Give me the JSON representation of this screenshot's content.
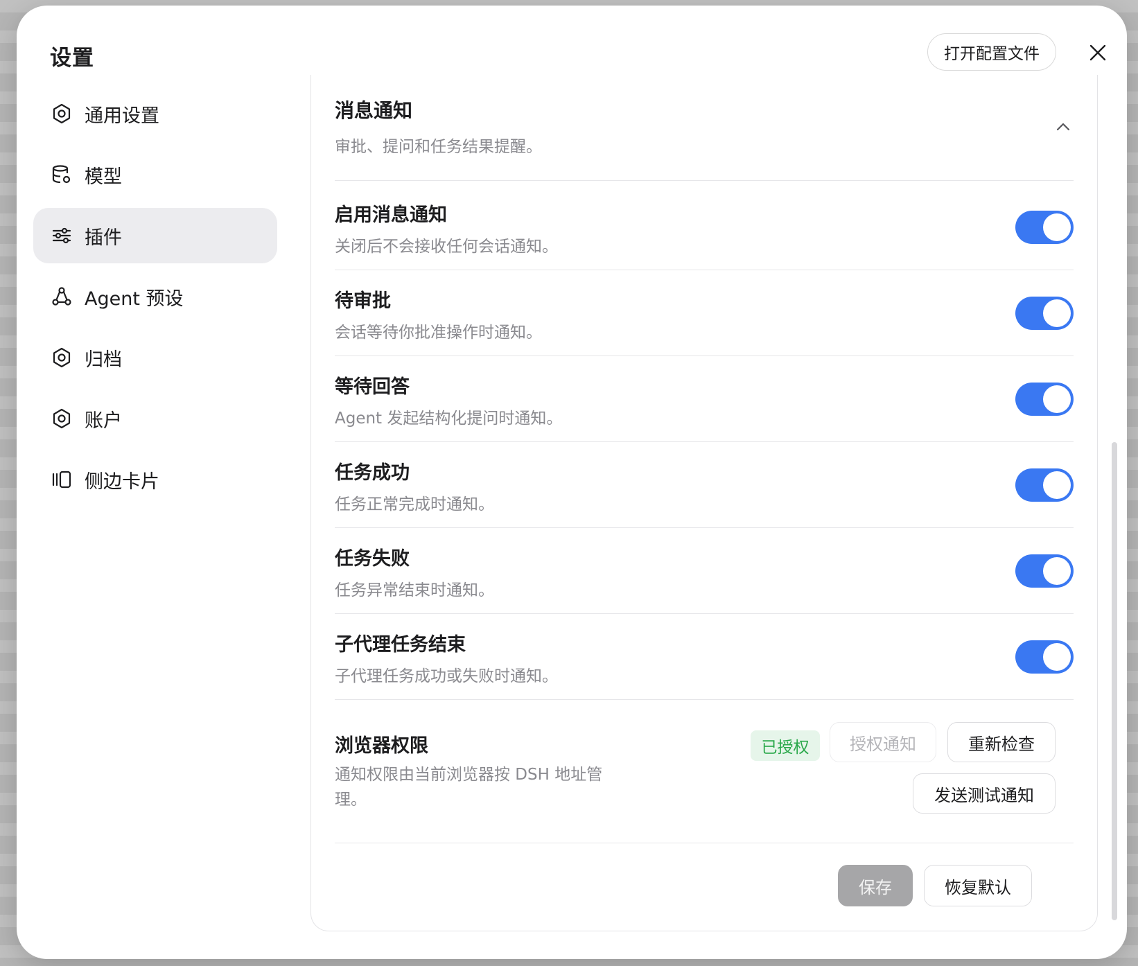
{
  "dialog": {
    "title": "设置",
    "open_config_label": "打开配置文件",
    "close_icon": "close-icon"
  },
  "sidebar": {
    "items": [
      {
        "label": "通用设置",
        "icon": "gear-icon",
        "active": false
      },
      {
        "label": "模型",
        "icon": "database-gear-icon",
        "active": false
      },
      {
        "label": "插件",
        "icon": "sliders-icon",
        "active": true
      },
      {
        "label": "Agent 预设",
        "icon": "agent-nodes-icon",
        "active": false
      },
      {
        "label": "归档",
        "icon": "gear-icon",
        "active": false
      },
      {
        "label": "账户",
        "icon": "gear-icon",
        "active": false
      },
      {
        "label": "侧边卡片",
        "icon": "side-cards-icon",
        "active": false
      }
    ]
  },
  "section": {
    "title": "消息通知",
    "subtitle": "审批、提问和任务结果提醒。",
    "expanded": true
  },
  "settings": [
    {
      "title": "启用消息通知",
      "desc": "关闭后不会接收任何会话通知。",
      "enabled": true
    },
    {
      "title": "待审批",
      "desc": "会话等待你批准操作时通知。",
      "enabled": true
    },
    {
      "title": "等待回答",
      "desc": "Agent 发起结构化提问时通知。",
      "enabled": true
    },
    {
      "title": "任务成功",
      "desc": "任务正常完成时通知。",
      "enabled": true
    },
    {
      "title": "任务失败",
      "desc": "任务异常结束时通知。",
      "enabled": true
    },
    {
      "title": "子代理任务结束",
      "desc": "子代理任务成功或失败时通知。",
      "enabled": true
    }
  ],
  "browser_permission": {
    "title": "浏览器权限",
    "desc": "通知权限由当前浏览器按 DSH 地址管理。",
    "status_badge": "已授权",
    "authorize_label": "授权通知",
    "recheck_label": "重新检查",
    "send_test_label": "发送测试通知"
  },
  "footer": {
    "save_label": "保存",
    "reset_label": "恢复默认"
  },
  "colors": {
    "accent": "#3a78f2",
    "success": "#2aa84a",
    "active_nav_bg": "#ececef"
  }
}
